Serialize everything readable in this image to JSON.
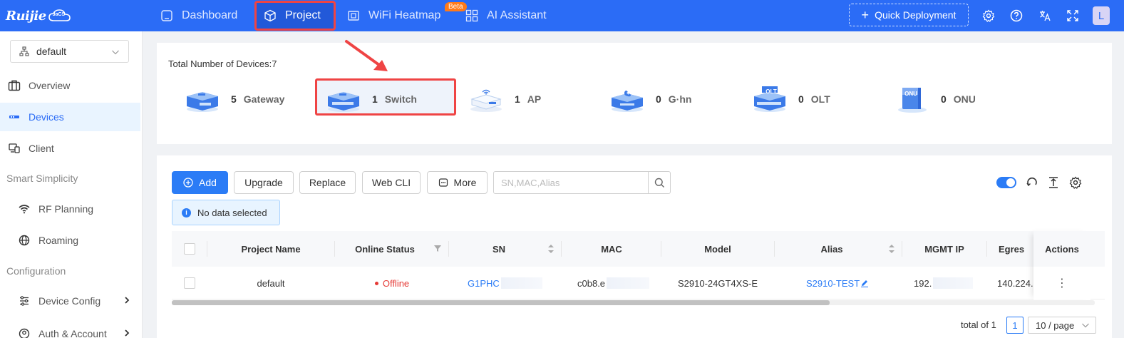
{
  "app": {
    "logo_text": "Ruijie",
    "logo_badge": "JaCS"
  },
  "topnav": {
    "items": [
      {
        "label": "Dashboard"
      },
      {
        "label": "Project"
      },
      {
        "label": "WiFi Heatmap"
      },
      {
        "label": "AI Assistant"
      }
    ],
    "beta_badge": "Beta",
    "quick_deployment": "Quick Deployment",
    "avatar_letter": "L"
  },
  "sidebar": {
    "selector_value": "default",
    "items": [
      {
        "label": "Overview"
      },
      {
        "label": "Devices"
      },
      {
        "label": "Client"
      }
    ],
    "groups": [
      {
        "label": "Smart Simplicity"
      },
      {
        "label": "Configuration"
      }
    ],
    "sub_items": [
      {
        "label": "RF Planning"
      },
      {
        "label": "Roaming"
      },
      {
        "label": "Device Config"
      },
      {
        "label": "Auth & Account"
      }
    ]
  },
  "summary": {
    "total_text": "Total Number of Devices:7",
    "types": [
      {
        "count": "5",
        "name": "Gateway"
      },
      {
        "count": "1",
        "name": "Switch"
      },
      {
        "count": "1",
        "name": "AP"
      },
      {
        "count": "0",
        "name": "G·hn"
      },
      {
        "count": "0",
        "name": "OLT"
      },
      {
        "count": "0",
        "name": "ONU"
      }
    ],
    "icon_labels": {
      "olt": "OLT",
      "onu": "ONU"
    }
  },
  "toolbar": {
    "add": "Add",
    "upgrade": "Upgrade",
    "replace": "Replace",
    "web_cli": "Web CLI",
    "more": "More",
    "search_placeholder": "SN,MAC,Alias"
  },
  "selection_info": "No data selected",
  "table": {
    "columns": [
      "Project Name",
      "Online Status",
      "SN",
      "MAC",
      "Model",
      "Alias",
      "MGMT IP",
      "Egres",
      "Actions"
    ],
    "rows": [
      {
        "project_name": "default",
        "online_status": "Offline",
        "sn": "G1PHC",
        "mac": "c0b8.e",
        "model": "S2910-24GT4XS-E",
        "alias": "S2910-TEST",
        "mgmt_ip": "192.",
        "egress": "140.224.",
        "actions": "⋮"
      }
    ]
  },
  "pagination": {
    "total": "total of 1",
    "current_page": "1",
    "page_size": "10 / page"
  },
  "colors": {
    "brand": "#2b6cf6",
    "highlight": "#ef4444",
    "offline": "#e53935",
    "link": "#2b7cf6"
  }
}
